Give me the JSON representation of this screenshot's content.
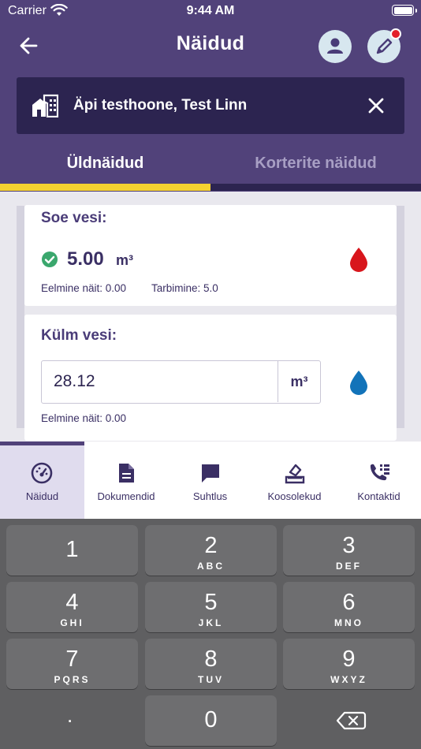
{
  "status_bar": {
    "carrier": "Carrier",
    "time": "9:44 AM"
  },
  "header": {
    "title": "Näidud"
  },
  "building": {
    "name": "Äpi testhoone, Test Linn"
  },
  "tabs": [
    {
      "label": "Üldnäidud",
      "active": true
    },
    {
      "label": "Korterite näidud",
      "active": false
    }
  ],
  "readings": [
    {
      "title": "Soe vesi:",
      "value": "5.00",
      "unit": "m³",
      "previous": "Eelmine näit: 0.00",
      "consumption": "Tarbimine: 5.0",
      "drop_color": "#d8161c",
      "status_icon": "check-circle-icon"
    },
    {
      "title": "Külm vesi:",
      "input_value": "28.12",
      "unit": "m³",
      "previous": "Eelmine näit: 0.00",
      "drop_color": "#1273b9"
    }
  ],
  "bottom_nav": [
    {
      "label": "Näidud",
      "icon": "gauge-icon",
      "active": true
    },
    {
      "label": "Dokumendid",
      "icon": "document-icon",
      "active": false
    },
    {
      "label": "Suhtlus",
      "icon": "chat-icon",
      "active": false
    },
    {
      "label": "Koosolekud",
      "icon": "ballot-box-icon",
      "active": false
    },
    {
      "label": "Kontaktid",
      "icon": "phone-contacts-icon",
      "active": false
    }
  ],
  "keypad": {
    "keys": [
      {
        "num": "1",
        "letters": ""
      },
      {
        "num": "2",
        "letters": "ABC"
      },
      {
        "num": "3",
        "letters": "DEF"
      },
      {
        "num": "4",
        "letters": "GHI"
      },
      {
        "num": "5",
        "letters": "JKL"
      },
      {
        "num": "6",
        "letters": "MNO"
      },
      {
        "num": "7",
        "letters": "PQRS"
      },
      {
        "num": "8",
        "letters": "TUV"
      },
      {
        "num": "9",
        "letters": "WXYZ"
      },
      {
        "num": "0",
        "letters": ""
      }
    ],
    "decimal": "."
  },
  "colors": {
    "header_bg": "#51427a",
    "banner_bg": "#2c2450",
    "tab_indicator": "#f5d130",
    "check": "#3aa76d"
  }
}
